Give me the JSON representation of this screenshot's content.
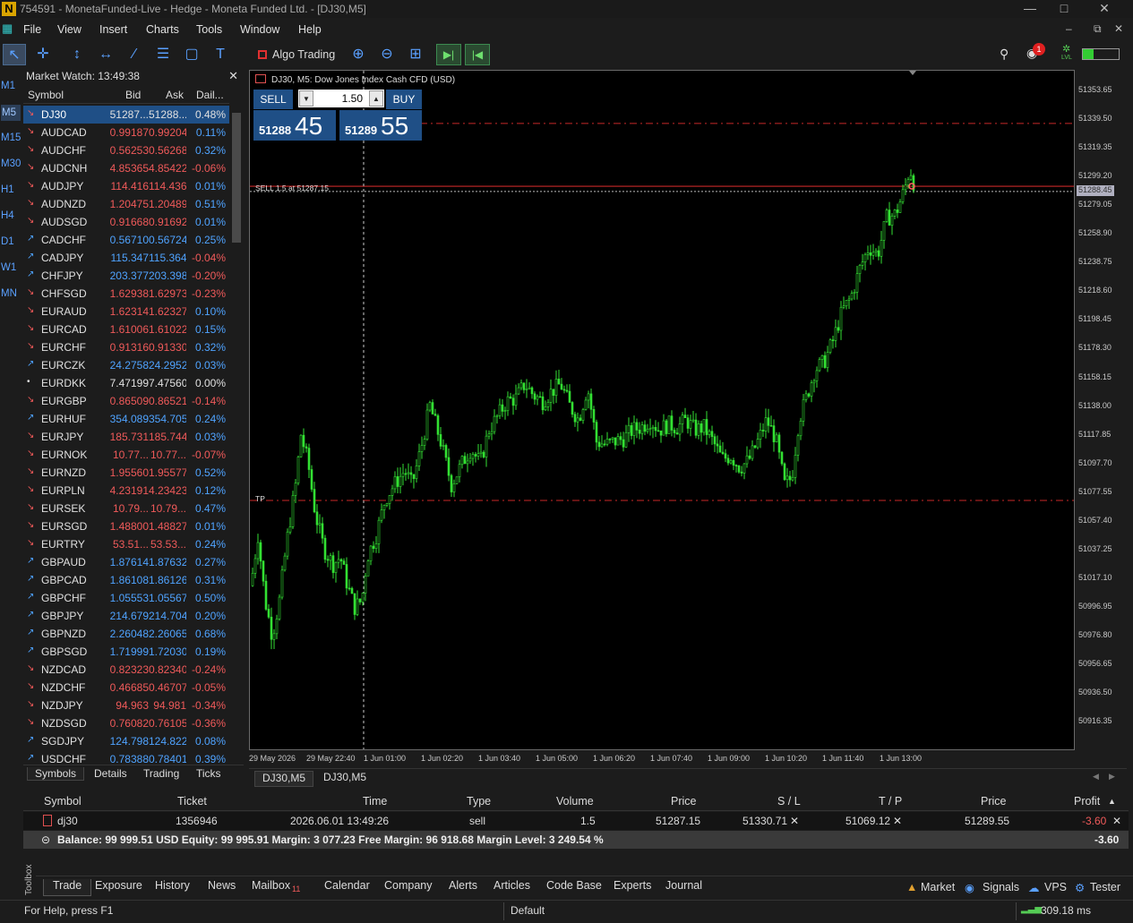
{
  "window": {
    "title": "754591 - MonetaFunded-Live - Hedge - Moneta Funded Ltd. - [DJ30,M5]",
    "logo": "N"
  },
  "menu": [
    "File",
    "View",
    "Insert",
    "Charts",
    "Tools",
    "Window",
    "Help"
  ],
  "toolbar": {
    "algo_label": "Algo Trading",
    "notification_count": "1",
    "lvl_label": "LVL"
  },
  "timeframes": [
    "M1",
    "M5",
    "M15",
    "M30",
    "H1",
    "H4",
    "D1",
    "W1",
    "MN"
  ],
  "selected_timeframe": "M5",
  "market_watch": {
    "title": "Market Watch: 13:49:38",
    "columns": [
      "Symbol",
      "Bid",
      "Ask",
      "Dail..."
    ],
    "rows": [
      {
        "s": "DJ30",
        "b": "51287...",
        "a": "51288...",
        "c": "0.48%",
        "dir": "dn",
        "sel": true
      },
      {
        "s": "AUDCAD",
        "b": "0.99187",
        "a": "0.99204",
        "c": "0.11%",
        "dir": "dn"
      },
      {
        "s": "AUDCHF",
        "b": "0.56253",
        "a": "0.56268",
        "c": "0.32%",
        "dir": "dn"
      },
      {
        "s": "AUDCNH",
        "b": "4.85365",
        "a": "4.85422",
        "c": "-0.06%",
        "dir": "dn"
      },
      {
        "s": "AUDJPY",
        "b": "114.416",
        "a": "114.436",
        "c": "0.01%",
        "dir": "dn"
      },
      {
        "s": "AUDNZD",
        "b": "1.20475",
        "a": "1.20489",
        "c": "0.51%",
        "dir": "dn"
      },
      {
        "s": "AUDSGD",
        "b": "0.91668",
        "a": "0.91692",
        "c": "0.01%",
        "dir": "dn"
      },
      {
        "s": "CADCHF",
        "b": "0.56710",
        "a": "0.56724",
        "c": "0.25%",
        "dir": "up"
      },
      {
        "s": "CADJPY",
        "b": "115.347",
        "a": "115.364",
        "c": "-0.04%",
        "dir": "up"
      },
      {
        "s": "CHFJPY",
        "b": "203.377",
        "a": "203.398",
        "c": "-0.20%",
        "dir": "up"
      },
      {
        "s": "CHFSGD",
        "b": "1.62938",
        "a": "1.62973",
        "c": "-0.23%",
        "dir": "dn"
      },
      {
        "s": "EURAUD",
        "b": "1.62314",
        "a": "1.62327",
        "c": "0.10%",
        "dir": "dn"
      },
      {
        "s": "EURCAD",
        "b": "1.61006",
        "a": "1.61022",
        "c": "0.15%",
        "dir": "dn"
      },
      {
        "s": "EURCHF",
        "b": "0.91316",
        "a": "0.91330",
        "c": "0.32%",
        "dir": "dn"
      },
      {
        "s": "EURCZK",
        "b": "24.2758",
        "a": "24.2952",
        "c": "0.03%",
        "dir": "up"
      },
      {
        "s": "EURDKK",
        "b": "7.47199",
        "a": "7.47560",
        "c": "0.00%",
        "dir": "neu"
      },
      {
        "s": "EURGBP",
        "b": "0.86509",
        "a": "0.86521",
        "c": "-0.14%",
        "dir": "dn"
      },
      {
        "s": "EURHUF",
        "b": "354.089",
        "a": "354.705",
        "c": "0.24%",
        "dir": "up"
      },
      {
        "s": "EURJPY",
        "b": "185.731",
        "a": "185.744",
        "c": "0.03%",
        "dir": "dn"
      },
      {
        "s": "EURNOK",
        "b": "10.77...",
        "a": "10.77...",
        "c": "-0.07%",
        "dir": "dn"
      },
      {
        "s": "EURNZD",
        "b": "1.95560",
        "a": "1.95577",
        "c": "0.52%",
        "dir": "dn"
      },
      {
        "s": "EURPLN",
        "b": "4.23191",
        "a": "4.23423",
        "c": "0.12%",
        "dir": "dn"
      },
      {
        "s": "EURSEK",
        "b": "10.79...",
        "a": "10.79...",
        "c": "0.47%",
        "dir": "dn"
      },
      {
        "s": "EURSGD",
        "b": "1.48800",
        "a": "1.48827",
        "c": "0.01%",
        "dir": "dn"
      },
      {
        "s": "EURTRY",
        "b": "53.51...",
        "a": "53.53...",
        "c": "0.24%",
        "dir": "dn"
      },
      {
        "s": "GBPAUD",
        "b": "1.87614",
        "a": "1.87632",
        "c": "0.27%",
        "dir": "up"
      },
      {
        "s": "GBPCAD",
        "b": "1.86108",
        "a": "1.86126",
        "c": "0.31%",
        "dir": "up"
      },
      {
        "s": "GBPCHF",
        "b": "1.05553",
        "a": "1.05567",
        "c": "0.50%",
        "dir": "up"
      },
      {
        "s": "GBPJPY",
        "b": "214.679",
        "a": "214.704",
        "c": "0.20%",
        "dir": "up"
      },
      {
        "s": "GBPNZD",
        "b": "2.26048",
        "a": "2.26065",
        "c": "0.68%",
        "dir": "up"
      },
      {
        "s": "GBPSGD",
        "b": "1.71999",
        "a": "1.72030",
        "c": "0.19%",
        "dir": "up"
      },
      {
        "s": "NZDCAD",
        "b": "0.82323",
        "a": "0.82340",
        "c": "-0.24%",
        "dir": "dn"
      },
      {
        "s": "NZDCHF",
        "b": "0.46685",
        "a": "0.46707",
        "c": "-0.05%",
        "dir": "dn"
      },
      {
        "s": "NZDJPY",
        "b": "94.963",
        "a": "94.981",
        "c": "-0.34%",
        "dir": "dn"
      },
      {
        "s": "NZDSGD",
        "b": "0.76082",
        "a": "0.76105",
        "c": "-0.36%",
        "dir": "dn"
      },
      {
        "s": "SGDJPY",
        "b": "124.798",
        "a": "124.822",
        "c": "0.08%",
        "dir": "up"
      },
      {
        "s": "USDCHF",
        "b": "0.78388",
        "a": "0.78401",
        "c": "0.39%",
        "dir": "up"
      }
    ],
    "tabs": [
      "Symbols",
      "Details",
      "Trading",
      "Ticks"
    ]
  },
  "chart": {
    "info": "DJ30, M5:  Dow Jones Index Cash CFD (USD)",
    "sell_label": "SELL",
    "buy_label": "BUY",
    "lot": "1.50",
    "sell_small": "51288",
    "sell_big": "45",
    "buy_small": "51289",
    "buy_big": "55",
    "sell_line_label": "SELL 1.5 at 51287.15",
    "tp_label": "TP",
    "current_price": "51288.45",
    "price_labels": [
      "51353.65",
      "51339.50",
      "51319.35",
      "51299.20",
      "51279.05",
      "51258.90",
      "51238.75",
      "51218.60",
      "51198.45",
      "51178.30",
      "51158.15",
      "51138.00",
      "51117.85",
      "51097.70",
      "51077.55",
      "51057.40",
      "51037.25",
      "51017.10",
      "50996.95",
      "50976.80",
      "50956.65",
      "50936.50",
      "50916.35"
    ],
    "time_labels": [
      "29 May 2026",
      "29 May 22:40",
      "1 Jun 01:00",
      "1 Jun 02:20",
      "1 Jun 03:40",
      "1 Jun 05:00",
      "1 Jun 06:20",
      "1 Jun 07:40",
      "1 Jun 09:00",
      "1 Jun 10:20",
      "1 Jun 11:40",
      "1 Jun 13:00"
    ],
    "tabs": [
      "DJ30,M5",
      "DJ30,M5"
    ],
    "colors": {
      "candle": "#33e033",
      "level": "#c82828",
      "bg": "#000000"
    }
  },
  "toolbox": {
    "columns": [
      "Symbol",
      "Ticket",
      "Time",
      "Type",
      "Volume",
      "Price",
      "S / L",
      "T / P",
      "Price",
      "Profit"
    ],
    "trade": {
      "symbol": "dj30",
      "ticket": "1356946",
      "time": "2026.06.01 13:49:26",
      "type": "sell",
      "volume": "1.5",
      "price": "51287.15",
      "sl": "51330.71",
      "tp": "51069.12",
      "cur": "51289.55",
      "profit": "-3.60"
    },
    "balance_line": "Balance: 99 999.51 USD  Equity: 99 995.91  Margin: 3 077.23  Free Margin: 96 918.68  Margin Level: 3 249.54 %",
    "total_profit": "-3.60",
    "label": "Toolbox",
    "tabs": [
      "Trade",
      "Exposure",
      "History",
      "News",
      "Mailbox",
      "Calendar",
      "Company",
      "Alerts",
      "Articles",
      "Code Base",
      "Experts",
      "Journal"
    ],
    "mailbox_count": "11",
    "right_tabs": [
      "Market",
      "Signals",
      "VPS",
      "Tester"
    ]
  },
  "status": {
    "help": "For Help, press F1",
    "profile": "Default",
    "ping": "309.18 ms"
  }
}
